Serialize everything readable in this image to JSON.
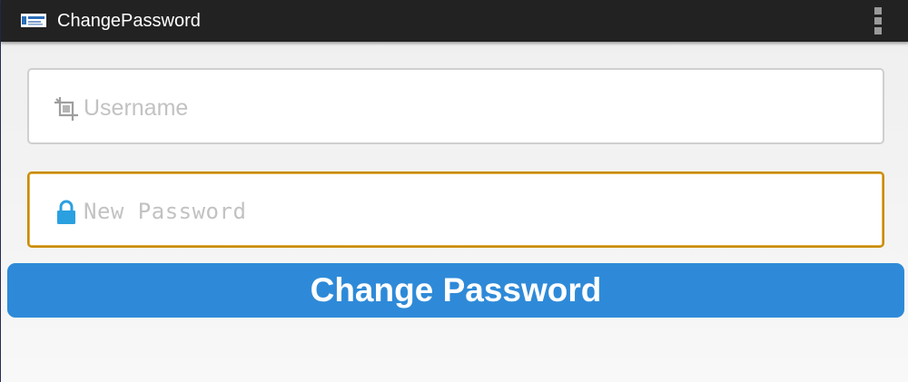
{
  "action_bar": {
    "title": "ChangePassword",
    "app_icon": "app-logo-icon",
    "overflow_icon": "more-vertical-icon",
    "background": "#222222"
  },
  "form": {
    "username": {
      "placeholder": "Username",
      "value": "",
      "icon": "crop-icon"
    },
    "new_password": {
      "placeholder": "New Password",
      "value": "",
      "icon": "lock-icon",
      "focused": true,
      "focus_color": "#c98a00"
    },
    "submit_label": "Change Password",
    "accent": "#2e8ad8"
  }
}
